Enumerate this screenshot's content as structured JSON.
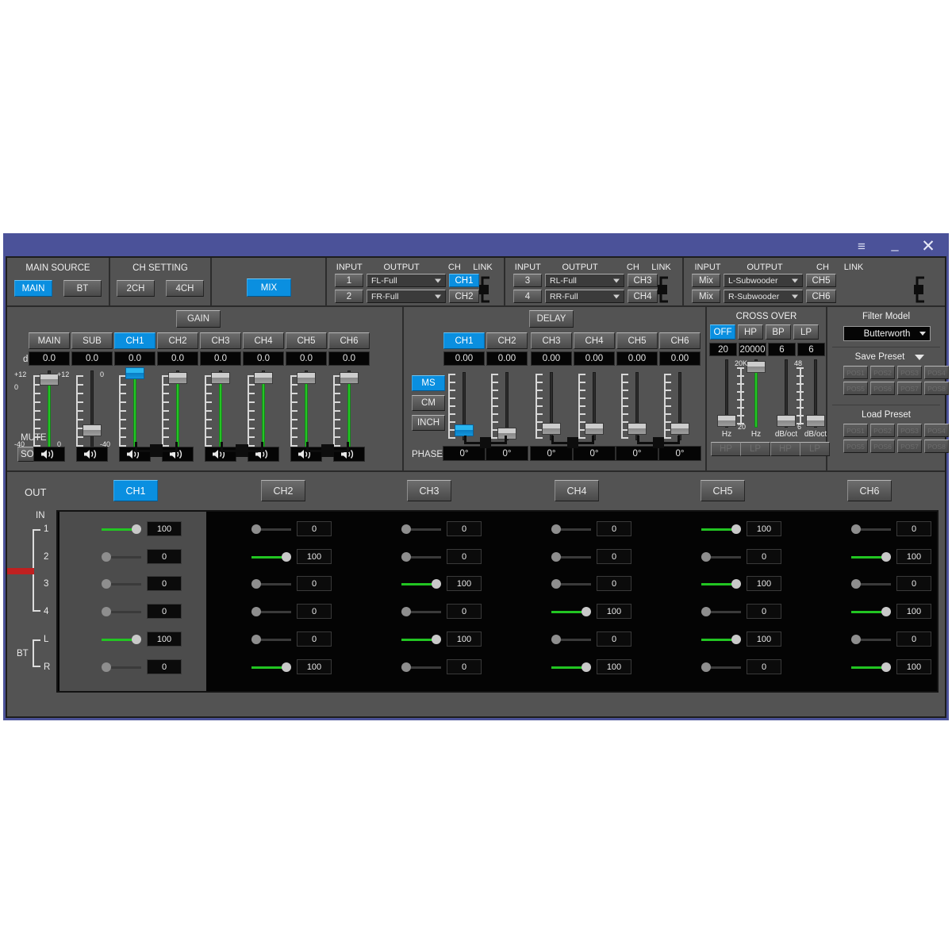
{
  "window": {
    "titlebar": {
      "menu_icon": "hamburger-icon",
      "minimize_icon": "minimize-icon",
      "close_icon": "close-icon",
      "menu_glyph": "≡",
      "minimize_glyph": "–",
      "close_glyph": "✕"
    },
    "accent_blue": "#0a8fe0",
    "frame_color": "#4b5299",
    "panel_gray": "#535353",
    "fader_green": "#25c425"
  },
  "top": {
    "main_source": {
      "title": "MAIN SOURCE",
      "buttons": [
        {
          "label": "MAIN",
          "selected": true
        },
        {
          "label": "BT",
          "selected": false
        }
      ]
    },
    "ch_setting": {
      "title": "CH SETTING",
      "buttons": [
        {
          "label": "2CH",
          "selected": false
        },
        {
          "label": "4CH",
          "selected": false
        }
      ]
    },
    "mix": {
      "label": "MIX",
      "selected": true
    },
    "routing_groups": [
      {
        "headers": {
          "input": "INPUT",
          "output": "OUTPUT",
          "ch": "CH",
          "link": "LINK"
        },
        "rows": [
          {
            "input": "1",
            "output": "FL-Full",
            "ch": "CH1",
            "ch_selected": true
          },
          {
            "input": "2",
            "output": "FR-Full",
            "ch": "CH2",
            "ch_selected": false
          }
        ]
      },
      {
        "headers": {
          "input": "INPUT",
          "output": "OUTPUT",
          "ch": "CH",
          "link": "LINK"
        },
        "rows": [
          {
            "input": "3",
            "output": "RL-Full",
            "ch": "CH3",
            "ch_selected": false
          },
          {
            "input": "4",
            "output": "RR-Full",
            "ch": "CH4",
            "ch_selected": false
          }
        ]
      },
      {
        "headers": {
          "input": "INPUT",
          "output": "OUTPUT",
          "ch": "CH",
          "link": "LINK"
        },
        "rows": [
          {
            "input": "Mix",
            "output": "L-Subwooder",
            "ch": "CH5",
            "ch_selected": false
          },
          {
            "input": "Mix",
            "output": "R-Subwooder",
            "ch": "CH6",
            "ch_selected": false
          }
        ]
      }
    ]
  },
  "gain": {
    "header": "GAIN",
    "db_label": "dB",
    "scale_top": "+12",
    "scale_zero": "0",
    "scale_bottom": "-40",
    "mute_label": "MUTE",
    "solo_label": "SOLO",
    "speaker_icon": "speaker-icon",
    "speaker_glyph": "🔊",
    "channels": [
      {
        "label": "MAIN",
        "selected": false,
        "value": "0.0"
      },
      {
        "label": "SUB",
        "selected": false,
        "value": "0.0"
      },
      {
        "label": "CH1",
        "selected": true,
        "value": "0.0"
      },
      {
        "label": "CH2",
        "selected": false,
        "value": "0.0"
      },
      {
        "label": "CH3",
        "selected": false,
        "value": "0.0"
      },
      {
        "label": "CH4",
        "selected": false,
        "value": "0.0"
      },
      {
        "label": "CH5",
        "selected": false,
        "value": "0.0"
      },
      {
        "label": "CH6",
        "selected": false,
        "value": "0.0"
      }
    ]
  },
  "delay": {
    "header": "DELAY",
    "units": [
      {
        "label": "MS",
        "selected": true
      },
      {
        "label": "CM",
        "selected": false
      },
      {
        "label": "INCH",
        "selected": false
      }
    ],
    "phase_label": "PHASE",
    "channels": [
      {
        "label": "CH1",
        "selected": true,
        "value": "0.00",
        "phase": "0°"
      },
      {
        "label": "CH2",
        "selected": false,
        "value": "0.00",
        "phase": "0°"
      },
      {
        "label": "CH3",
        "selected": false,
        "value": "0.00",
        "phase": "0°"
      },
      {
        "label": "CH4",
        "selected": false,
        "value": "0.00",
        "phase": "0°"
      },
      {
        "label": "CH5",
        "selected": false,
        "value": "0.00",
        "phase": "0°"
      },
      {
        "label": "CH6",
        "selected": false,
        "value": "0.00",
        "phase": "0°"
      }
    ]
  },
  "crossover": {
    "title": "CROSS OVER",
    "modes": [
      {
        "label": "OFF",
        "selected": true
      },
      {
        "label": "HP",
        "selected": false
      },
      {
        "label": "BP",
        "selected": false
      },
      {
        "label": "LP",
        "selected": false
      }
    ],
    "values": [
      "20",
      "20000",
      "6",
      "6"
    ],
    "unit_labels": [
      "Hz",
      "Hz",
      "dB/oct",
      "dB/oct"
    ],
    "filter_buttons": [
      "HP",
      "LP",
      "HP",
      "LP"
    ],
    "freq_scale_top": "20K",
    "freq_scale_bottom": "20",
    "slope_scale_top": "48",
    "slope_scale_bottom": "6"
  },
  "filter_model": {
    "title": "Filter Model",
    "selected": "Butterworth"
  },
  "save_preset": {
    "title": "Save Preset",
    "buttons": [
      "POS1",
      "POS2",
      "POS3",
      "POS4",
      "POS5",
      "POS6",
      "POS7",
      "POS8"
    ]
  },
  "load_preset": {
    "title": "Load Preset",
    "buttons": [
      "POS1",
      "POS2",
      "POS3",
      "POS4",
      "POS5",
      "POS6",
      "POS7",
      "POS8"
    ]
  },
  "mixer": {
    "out_label": "OUT",
    "in_label": "IN",
    "bt_label": "BT",
    "out_tabs": [
      {
        "label": "CH1",
        "selected": true
      },
      {
        "label": "CH2",
        "selected": false
      },
      {
        "label": "CH3",
        "selected": false
      },
      {
        "label": "CH4",
        "selected": false
      },
      {
        "label": "CH5",
        "selected": false
      },
      {
        "label": "CH6",
        "selected": false
      }
    ],
    "in_labels": [
      "1",
      "2",
      "3",
      "4",
      "L",
      "R"
    ],
    "matrix": [
      {
        "out": "CH1",
        "highlighted": true,
        "values": [
          100,
          0,
          0,
          0,
          100,
          0
        ]
      },
      {
        "out": "CH2",
        "highlighted": false,
        "values": [
          0,
          100,
          0,
          0,
          0,
          100
        ]
      },
      {
        "out": "CH3",
        "highlighted": false,
        "values": [
          0,
          0,
          100,
          0,
          100,
          0
        ]
      },
      {
        "out": "CH4",
        "highlighted": false,
        "values": [
          0,
          0,
          0,
          100,
          0,
          100
        ]
      },
      {
        "out": "CH5",
        "highlighted": false,
        "values": [
          100,
          0,
          100,
          0,
          100,
          0
        ]
      },
      {
        "out": "CH6",
        "highlighted": false,
        "values": [
          0,
          100,
          0,
          100,
          0,
          100
        ]
      }
    ]
  }
}
